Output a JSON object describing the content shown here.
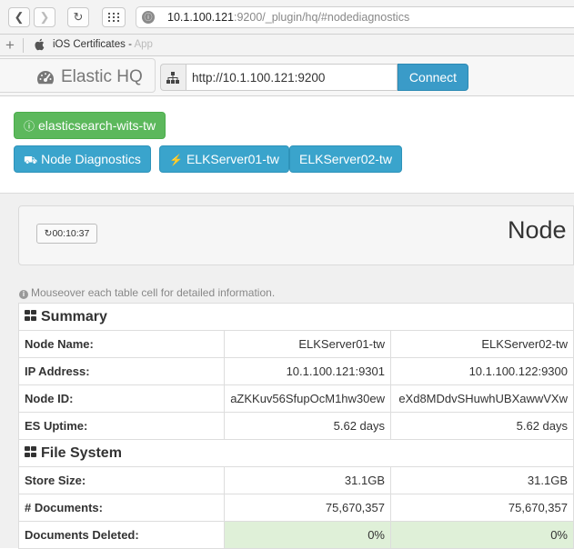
{
  "browser": {
    "url_host": "10.1.100.121",
    "url_rest": ":9200/_plugin/hq/#nodediagnostics",
    "bookmark_label": "iOS Certificates - ",
    "bookmark_fade": "App"
  },
  "header": {
    "brand": "Elastic HQ",
    "connect_url": "http://10.1.100.121:9200",
    "connect_label": "Connect"
  },
  "cluster_button": "elasticsearch-wits-tw",
  "nav_buttons": {
    "diagnostics": "Node Diagnostics",
    "server1": "ELKServer01-tw",
    "server2": "ELKServer02-tw"
  },
  "panel": {
    "timer": "00:10:37",
    "title": "Node"
  },
  "hint": "Mouseover each table cell for detailed information.",
  "table": {
    "summary": {
      "heading": "Summary",
      "rows": [
        {
          "label": "Node Name:",
          "v1": "ELKServer01-tw",
          "v2": "ELKServer02-tw"
        },
        {
          "label": "IP Address:",
          "v1": "10.1.100.121:9301",
          "v2": "10.1.100.122:9300"
        },
        {
          "label": "Node ID:",
          "v1": "aZKKuv56SfupOcM1hw30ew",
          "v2": "eXd8MDdvSHuwhUBXawwVXw"
        },
        {
          "label": "ES Uptime:",
          "v1": "5.62 days",
          "v2": "5.62 days"
        }
      ]
    },
    "filesystem": {
      "heading": "File System",
      "rows": [
        {
          "label": "Store Size:",
          "v1": "31.1GB",
          "v2": "31.1GB"
        },
        {
          "label": "# Documents:",
          "v1": "75,670,357",
          "v2": "75,670,357"
        },
        {
          "label": "Documents Deleted:",
          "v1": "0%",
          "v2": "0%"
        }
      ]
    }
  },
  "colors": {
    "green": "#5cb85c",
    "blue": "#3aa4cc",
    "ok_cell": "#dff0d8"
  }
}
